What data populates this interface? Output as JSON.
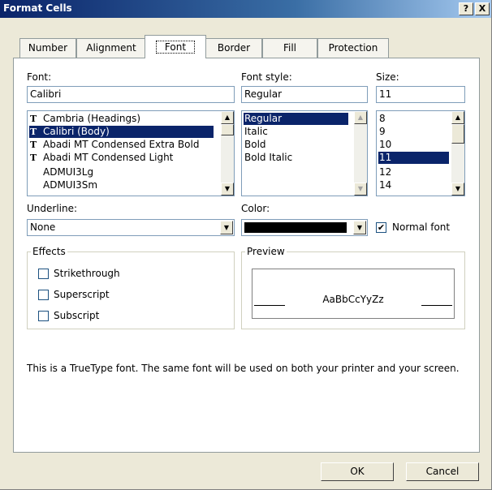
{
  "window": {
    "title": "Format Cells",
    "help_label": "?",
    "close_label": "X"
  },
  "tabs": [
    "Number",
    "Alignment",
    "Font",
    "Border",
    "Fill",
    "Protection"
  ],
  "font": {
    "label": "Font:",
    "value": "Calibri",
    "items": [
      {
        "tt": "T",
        "label": "Cambria (Headings)"
      },
      {
        "tt": "T",
        "label": "Calibri (Body)"
      },
      {
        "tt": "T",
        "label": "Abadi MT Condensed Extra Bold"
      },
      {
        "tt": "T",
        "label": "Abadi MT Condensed Light"
      },
      {
        "tt": "",
        "label": "ADMUI3Lg"
      },
      {
        "tt": "",
        "label": "ADMUI3Sm"
      }
    ]
  },
  "style": {
    "label": "Font style:",
    "value": "Regular",
    "items": [
      "Regular",
      "Italic",
      "Bold",
      "Bold Italic"
    ]
  },
  "size": {
    "label": "Size:",
    "value": "11",
    "items": [
      "8",
      "9",
      "10",
      "11",
      "12",
      "14"
    ]
  },
  "underline": {
    "label": "Underline:",
    "value": "None"
  },
  "color": {
    "label": "Color:",
    "swatch": "#000000"
  },
  "normal_font": {
    "label": "Normal font",
    "checked": true,
    "mark": "✔"
  },
  "effects": {
    "title": "Effects",
    "items": [
      "Strikethrough",
      "Superscript",
      "Subscript"
    ]
  },
  "preview": {
    "title": "Preview",
    "text": "AaBbCcYyZz"
  },
  "info": "This is a TrueType font.  The same font will be used on both your printer and your screen.",
  "buttons": {
    "ok": "OK",
    "cancel": "Cancel"
  },
  "colors": {
    "selection": "#0a246a",
    "titlebar": "#0a246a"
  }
}
